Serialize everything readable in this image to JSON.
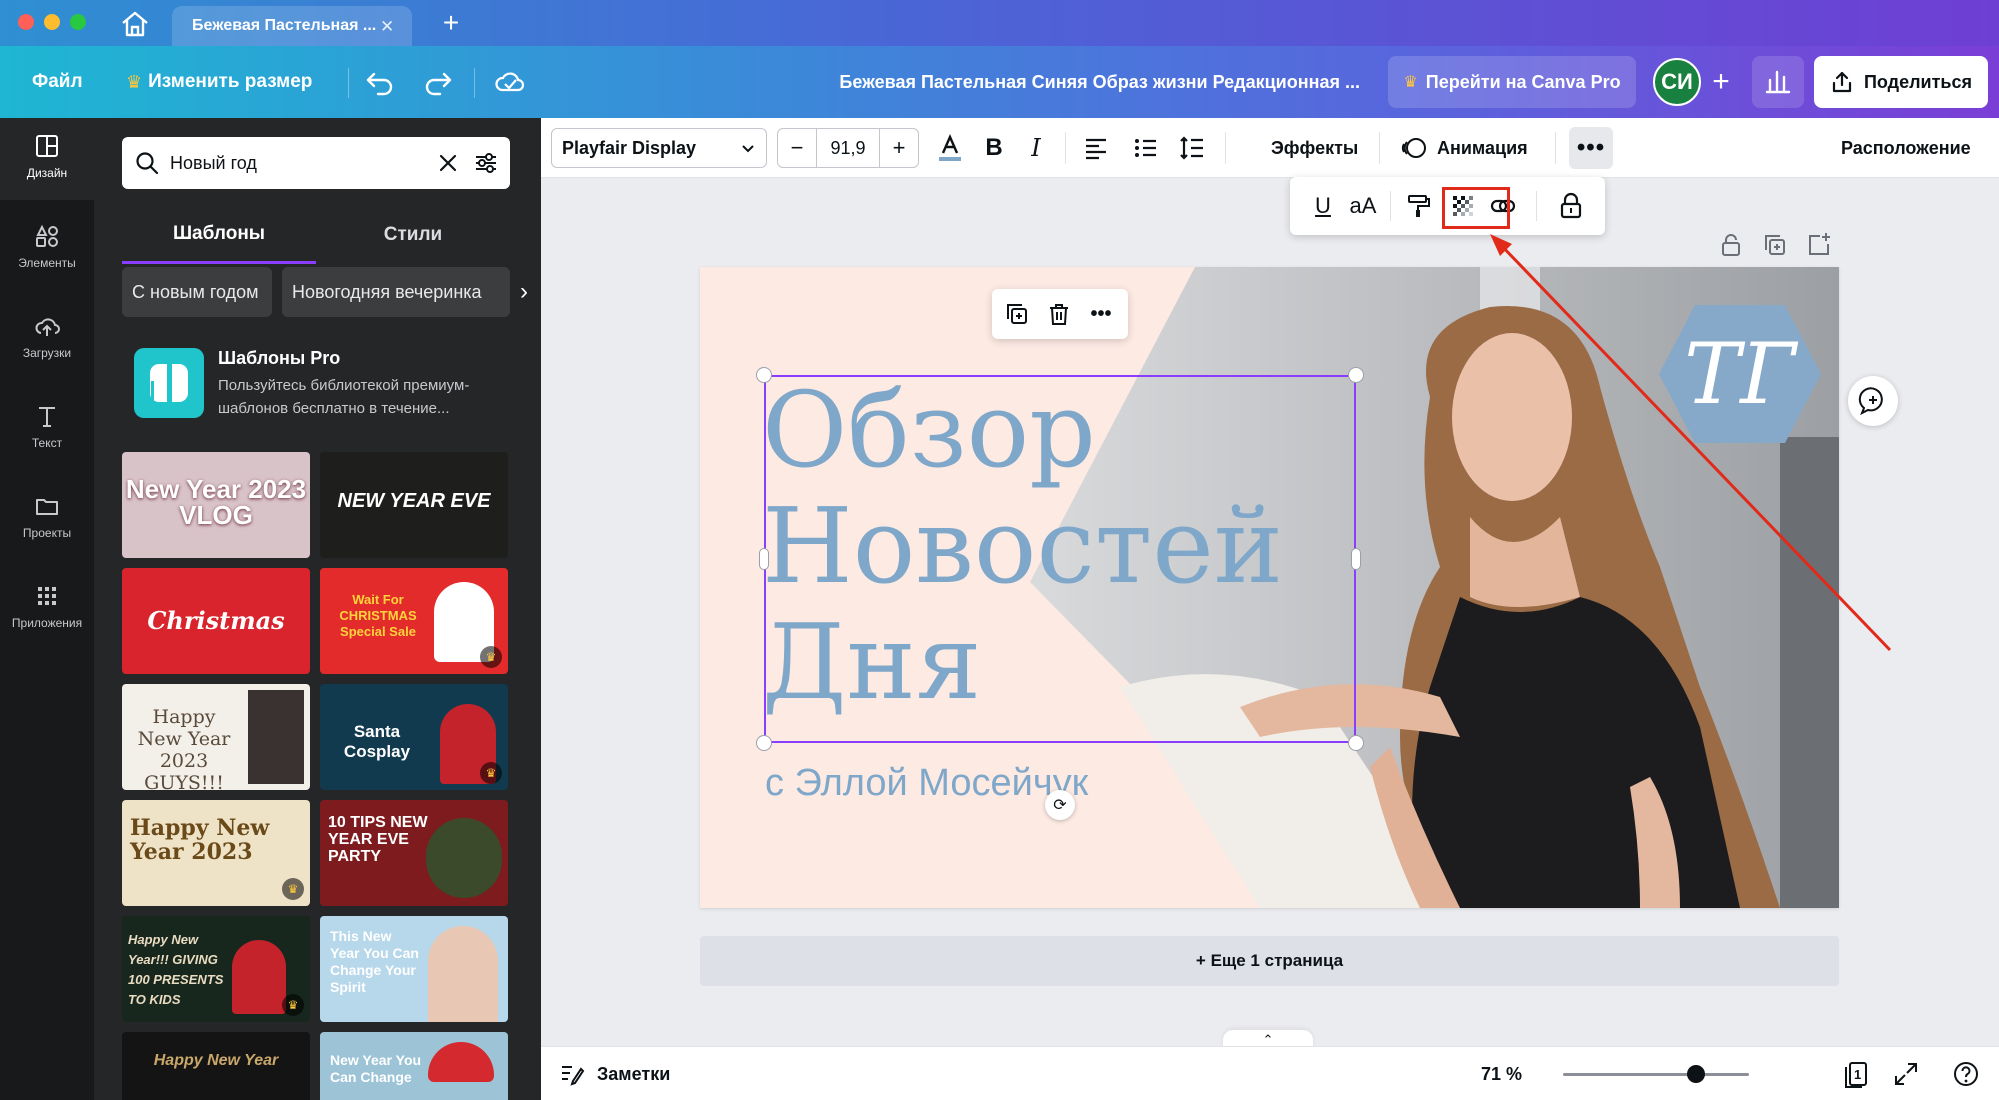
{
  "browser": {
    "tab_title": "Бежевая Пастельная ..."
  },
  "header": {
    "file": "Файл",
    "resize": "Изменить размер",
    "doc_title": "Бежевая Пастельная Синяя Образ жизни Редакционная ...",
    "pro_button": "Перейти на Canva Pro",
    "avatar_initials": "СИ",
    "share": "Поделиться"
  },
  "rail": {
    "items": [
      {
        "label": "Дизайн",
        "icon": "layout-icon"
      },
      {
        "label": "Элементы",
        "icon": "shapes-icon"
      },
      {
        "label": "Загрузки",
        "icon": "cloud-upload-icon"
      },
      {
        "label": "Текст",
        "icon": "text-t-icon"
      },
      {
        "label": "Проекты",
        "icon": "folder-icon"
      },
      {
        "label": "Приложения",
        "icon": "apps-grid-icon"
      }
    ]
  },
  "panel": {
    "search_value": "Новый год",
    "tabs": [
      "Шаблоны",
      "Стили"
    ],
    "chips": [
      "С новым годом",
      "Новогодняя вечеринка"
    ],
    "pro_title": "Шаблоны Pro",
    "pro_desc": "Пользуйтесь библиотекой премиум-шаблонов бесплатно в течение...",
    "thumbs": [
      {
        "text": "New Year 2023 VLOG",
        "bg": "#d8c3c8",
        "fg": "#ffffff"
      },
      {
        "text": "NEW YEAR EVE",
        "bg": "#1e1e1c",
        "fg": "#ffffff"
      },
      {
        "text": "Christmas",
        "bg": "#d9232d",
        "fg": "#ffffff"
      },
      {
        "text": "Wait For CHRISTMAS Special Sale",
        "bg": "#e32b2b",
        "fg": "#ffd43b"
      },
      {
        "text": "Happy New Year 2023 GUYS!!!",
        "bg": "#f3f0ea",
        "fg": "#5a4a3a"
      },
      {
        "text": "Santa Cosplay",
        "bg": "#123a4f",
        "fg": "#ffffff"
      },
      {
        "text": "Happy New Year 2023",
        "bg": "#efe3c7",
        "fg": "#6b4a1a"
      },
      {
        "text": "10 TIPS NEW YEAR EVE PARTY",
        "bg": "#7e1b1e",
        "fg": "#ffffff"
      },
      {
        "text": "Happy New Year!!! GIVING 100 PRESENTS TO KIDS",
        "bg": "#17271e",
        "fg": "#e9dcc0"
      },
      {
        "text": "This New Year You Can Change Your Spirit",
        "bg": "#b7d7ea",
        "fg": "#ffffff"
      },
      {
        "text": "Happy New Year",
        "bg": "#141414",
        "fg": "#c9a86a"
      },
      {
        "text": "New Year You Can Change",
        "bg": "#9cc3d6",
        "fg": "#ffffff"
      }
    ]
  },
  "toolbar": {
    "font_name": "Playfair Display",
    "font_size": "91,9",
    "effects": "Эффекты",
    "animation": "Анимация",
    "position": "Расположение"
  },
  "canvas": {
    "heading": "Обзор\nНовостей\nДня",
    "subheading": "с Эллой Мосейчук",
    "logo_text": "ТГ",
    "bg_color": "#fdeae3",
    "text_color": "#7fa7c9"
  },
  "add_page": "+ Еще 1 страница",
  "bottom": {
    "notes": "Заметки",
    "zoom": "71 %",
    "zoom_value": 71,
    "page_count": "1"
  }
}
